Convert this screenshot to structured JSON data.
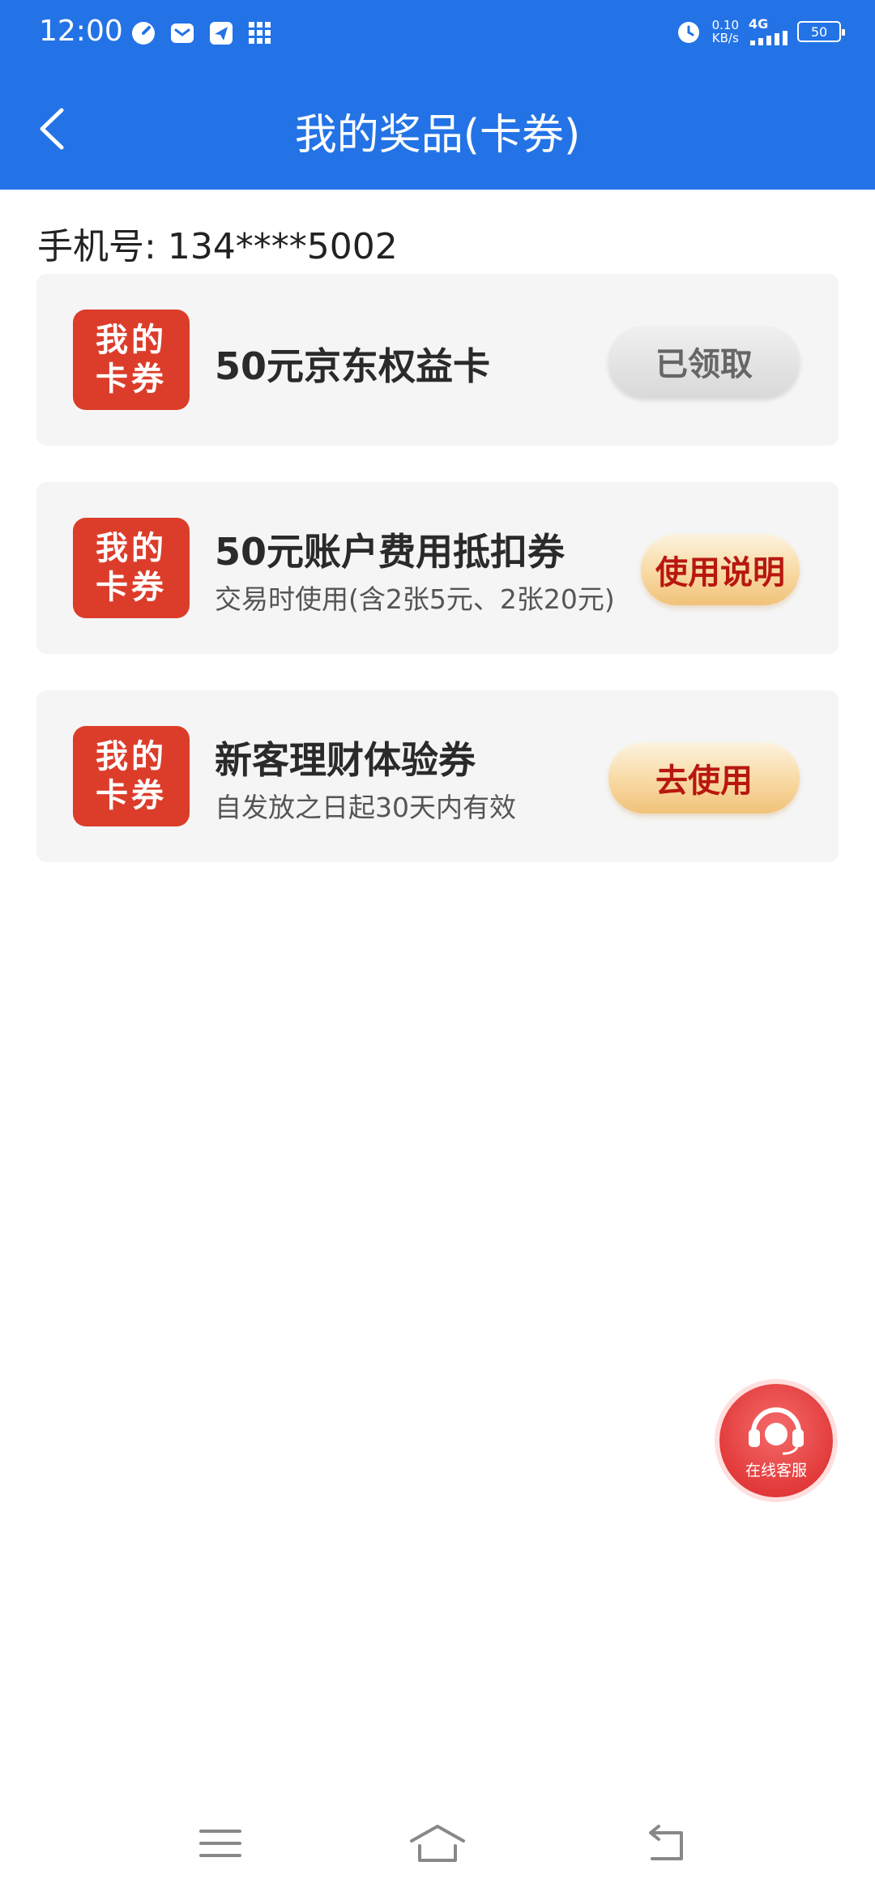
{
  "status_bar": {
    "time": "12:00",
    "net_speed_value": "0.10",
    "net_speed_unit": "KB/s",
    "network": "4G",
    "battery": "50",
    "icons": [
      "speedometer-icon",
      "mail-icon",
      "send-icon",
      "grid-icon",
      "alarm-icon",
      "signal-icon"
    ]
  },
  "header": {
    "title": "我的奖品(卡券)",
    "back_icon": "back-arrow-icon"
  },
  "account": {
    "label": "手机号:",
    "phone": "134****5002"
  },
  "coupons": [
    {
      "badge_line1": "我的",
      "badge_line2": "卡券",
      "title": "50元京东权益卡",
      "subtitle": "",
      "action": "已领取",
      "action_style": "claimed"
    },
    {
      "badge_line1": "我的",
      "badge_line2": "卡券",
      "title": "50元账户费用抵扣券",
      "subtitle": "交易时使用(含2张5元、2张20元)",
      "action": "使用说明",
      "action_style": "gold"
    },
    {
      "badge_line1": "我的",
      "badge_line2": "卡券",
      "title": "新客理财体验券",
      "subtitle": "自发放之日起30天内有效",
      "action": "去使用",
      "action_style": "gold"
    }
  ],
  "service": {
    "label": "在线客服",
    "icon": "headset-icon"
  },
  "colors": {
    "header_blue": "#2373e6",
    "badge_red": "#dc3d2b",
    "action_red_text": "#b8170f",
    "card_bg": "#f5f5f5"
  },
  "system_nav": {
    "icons": [
      "menu-icon",
      "home-icon",
      "back-icon"
    ]
  }
}
